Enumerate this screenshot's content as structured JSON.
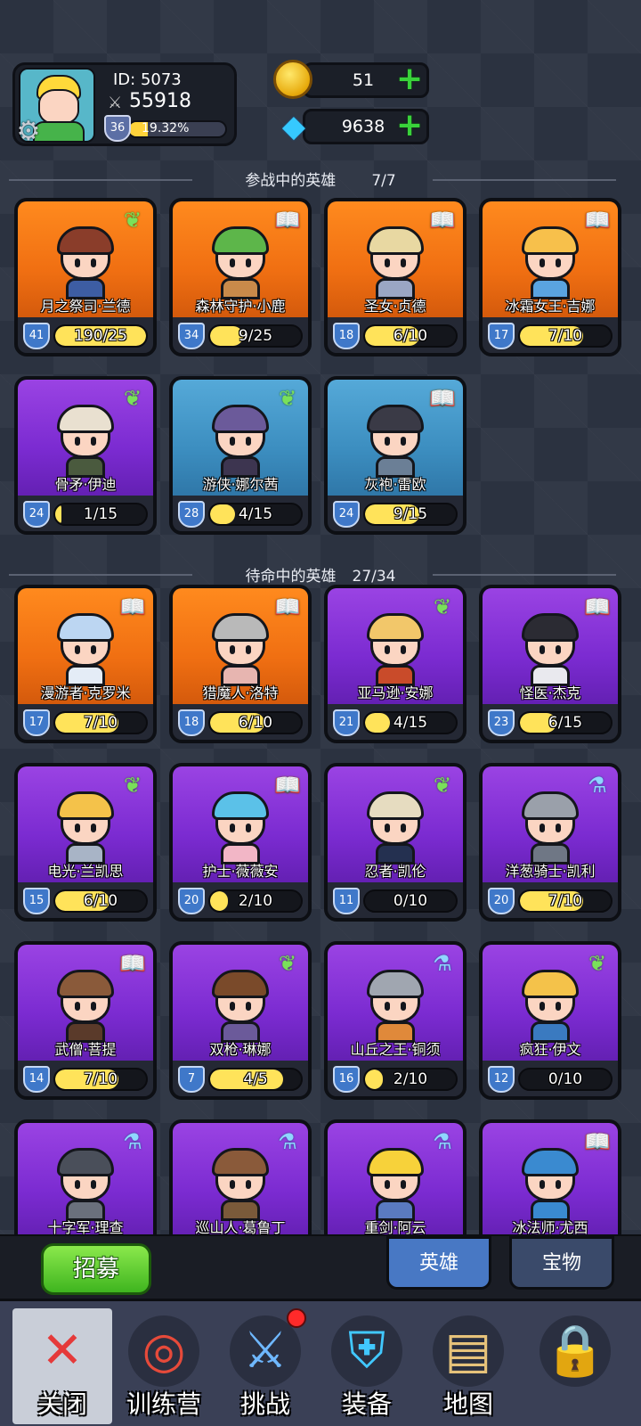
{
  "player": {
    "id_label": "ID: 5073",
    "power": "55918",
    "level": "36",
    "xp_percent": "19.32%",
    "xp_fraction": 0.1932
  },
  "resources": {
    "gold": "51",
    "gems": "9638"
  },
  "sections": {
    "active": {
      "title": "参战中的英雄",
      "count": "7/7"
    },
    "standby": {
      "title": "待命中的英雄",
      "count": "27/34"
    }
  },
  "active_heroes": [
    {
      "name": "月之祭司·兰德",
      "level": "41",
      "progress": "190/25",
      "fill": 1.0,
      "bg": "orange",
      "type": "wing",
      "hair": "#8a3d2a",
      "body": "#3d5da3"
    },
    {
      "name": "森林守护·小鹿",
      "level": "34",
      "progress": "9/25",
      "fill": 0.36,
      "bg": "orange",
      "type": "book",
      "hair": "#5db64a",
      "body": "#c98a4a"
    },
    {
      "name": "圣女·贞德",
      "level": "18",
      "progress": "6/10",
      "fill": 0.6,
      "bg": "orange",
      "type": "book",
      "hair": "#e8d8a2",
      "body": "#9aa6c4"
    },
    {
      "name": "冰霜女王·吉娜",
      "level": "17",
      "progress": "7/10",
      "fill": 0.7,
      "bg": "orange",
      "type": "book",
      "hair": "#f7c04b",
      "body": "#5aa4e0"
    },
    {
      "name": "骨矛·伊迪",
      "level": "24",
      "progress": "1/15",
      "fill": 0.067,
      "bg": "purple",
      "type": "wing",
      "hair": "#e9e0d0",
      "body": "#4a5a3e"
    },
    {
      "name": "游侠·娜尔茜",
      "level": "28",
      "progress": "4/15",
      "fill": 0.27,
      "bg": "blue",
      "type": "wing",
      "hair": "#6b5a9a",
      "body": "#3d3550"
    },
    {
      "name": "灰袍·雷欧",
      "level": "24",
      "progress": "9/15",
      "fill": 0.6,
      "bg": "blue",
      "type": "book",
      "hair": "#3a3a46",
      "body": "#6b7f96"
    }
  ],
  "standby_heroes": [
    {
      "name": "漫游者·克罗米",
      "level": "17",
      "progress": "7/10",
      "fill": 0.7,
      "bg": "orange",
      "type": "book",
      "hair": "#bcd6f2",
      "body": "#e4ecf6"
    },
    {
      "name": "猎魔人·洛特",
      "level": "18",
      "progress": "6/10",
      "fill": 0.6,
      "bg": "orange",
      "type": "book",
      "hair": "#b9b9b9",
      "body": "#e7b5b0"
    },
    {
      "name": "亚马逊·安娜",
      "level": "21",
      "progress": "4/15",
      "fill": 0.27,
      "bg": "purple",
      "type": "wing",
      "hair": "#f2c76a",
      "body": "#c94b2a"
    },
    {
      "name": "怪医·杰克",
      "level": "23",
      "progress": "6/15",
      "fill": 0.4,
      "bg": "purple",
      "type": "book",
      "hair": "#2b2b33",
      "body": "#e9e9ee"
    },
    {
      "name": "电光·兰凯思",
      "level": "15",
      "progress": "6/10",
      "fill": 0.6,
      "bg": "purple",
      "type": "wing",
      "hair": "#f4c24a",
      "body": "#a8b4c6"
    },
    {
      "name": "护士·薇薇安",
      "level": "20",
      "progress": "2/10",
      "fill": 0.2,
      "bg": "purple",
      "type": "book",
      "hair": "#5bc1e8",
      "body": "#f2b6c6"
    },
    {
      "name": "忍者·凯伦",
      "level": "11",
      "progress": "0/10",
      "fill": 0.0,
      "bg": "purple",
      "type": "wing",
      "hair": "#e6dcc0",
      "body": "#243050"
    },
    {
      "name": "洋葱骑士·凯利",
      "level": "20",
      "progress": "7/10",
      "fill": 0.7,
      "bg": "purple",
      "type": "potion",
      "hair": "#9aa0aa",
      "body": "#6f7785"
    },
    {
      "name": "武僧·菩提",
      "level": "14",
      "progress": "7/10",
      "fill": 0.7,
      "bg": "purple",
      "type": "book",
      "hair": "#8a5a3a",
      "body": "#5a3a2a"
    },
    {
      "name": "双枪·琳娜",
      "level": "7",
      "progress": "4/5",
      "fill": 0.8,
      "bg": "purple",
      "type": "wing",
      "hair": "#7a4a2a",
      "body": "#6b5a9a"
    },
    {
      "name": "山丘之王·铜须",
      "level": "16",
      "progress": "2/10",
      "fill": 0.2,
      "bg": "purple",
      "type": "potion",
      "hair": "#a0a6b0",
      "body": "#e0893a"
    },
    {
      "name": "疯狂·伊文",
      "level": "12",
      "progress": "0/10",
      "fill": 0.0,
      "bg": "purple",
      "type": "wing",
      "hair": "#f4c24a",
      "body": "#3a7ac0"
    },
    {
      "name": "十字军·理查",
      "level": "",
      "progress": "",
      "fill": 0.0,
      "bg": "purple",
      "type": "potion",
      "hair": "#4a4f5a",
      "body": "#6a707c"
    },
    {
      "name": "巡山人·葛鲁丁",
      "level": "",
      "progress": "",
      "fill": 0.0,
      "bg": "purple",
      "type": "potion",
      "hair": "#8a5a3a",
      "body": "#7a5a3a"
    },
    {
      "name": "重剑·阿云",
      "level": "",
      "progress": "",
      "fill": 0.0,
      "bg": "purple",
      "type": "potion",
      "hair": "#f7d23a",
      "body": "#5a7ac0"
    },
    {
      "name": "冰法师·尤西",
      "level": "",
      "progress": "",
      "fill": 0.0,
      "bg": "purple",
      "type": "book",
      "hair": "#3a8ad0",
      "body": "#3a8ad0"
    }
  ],
  "actions": {
    "recruit": "招募",
    "tab_hero": "英雄",
    "tab_treasure": "宝物"
  },
  "nav": [
    {
      "label": "关闭",
      "icon": "close-icon"
    },
    {
      "label": "训练营",
      "icon": "target-icon"
    },
    {
      "label": "挑战",
      "icon": "sword-icon"
    },
    {
      "label": "装备",
      "icon": "armor-icon"
    },
    {
      "label": "地图",
      "icon": "map-icon"
    },
    {
      "label": "",
      "icon": "locked-icon"
    }
  ]
}
